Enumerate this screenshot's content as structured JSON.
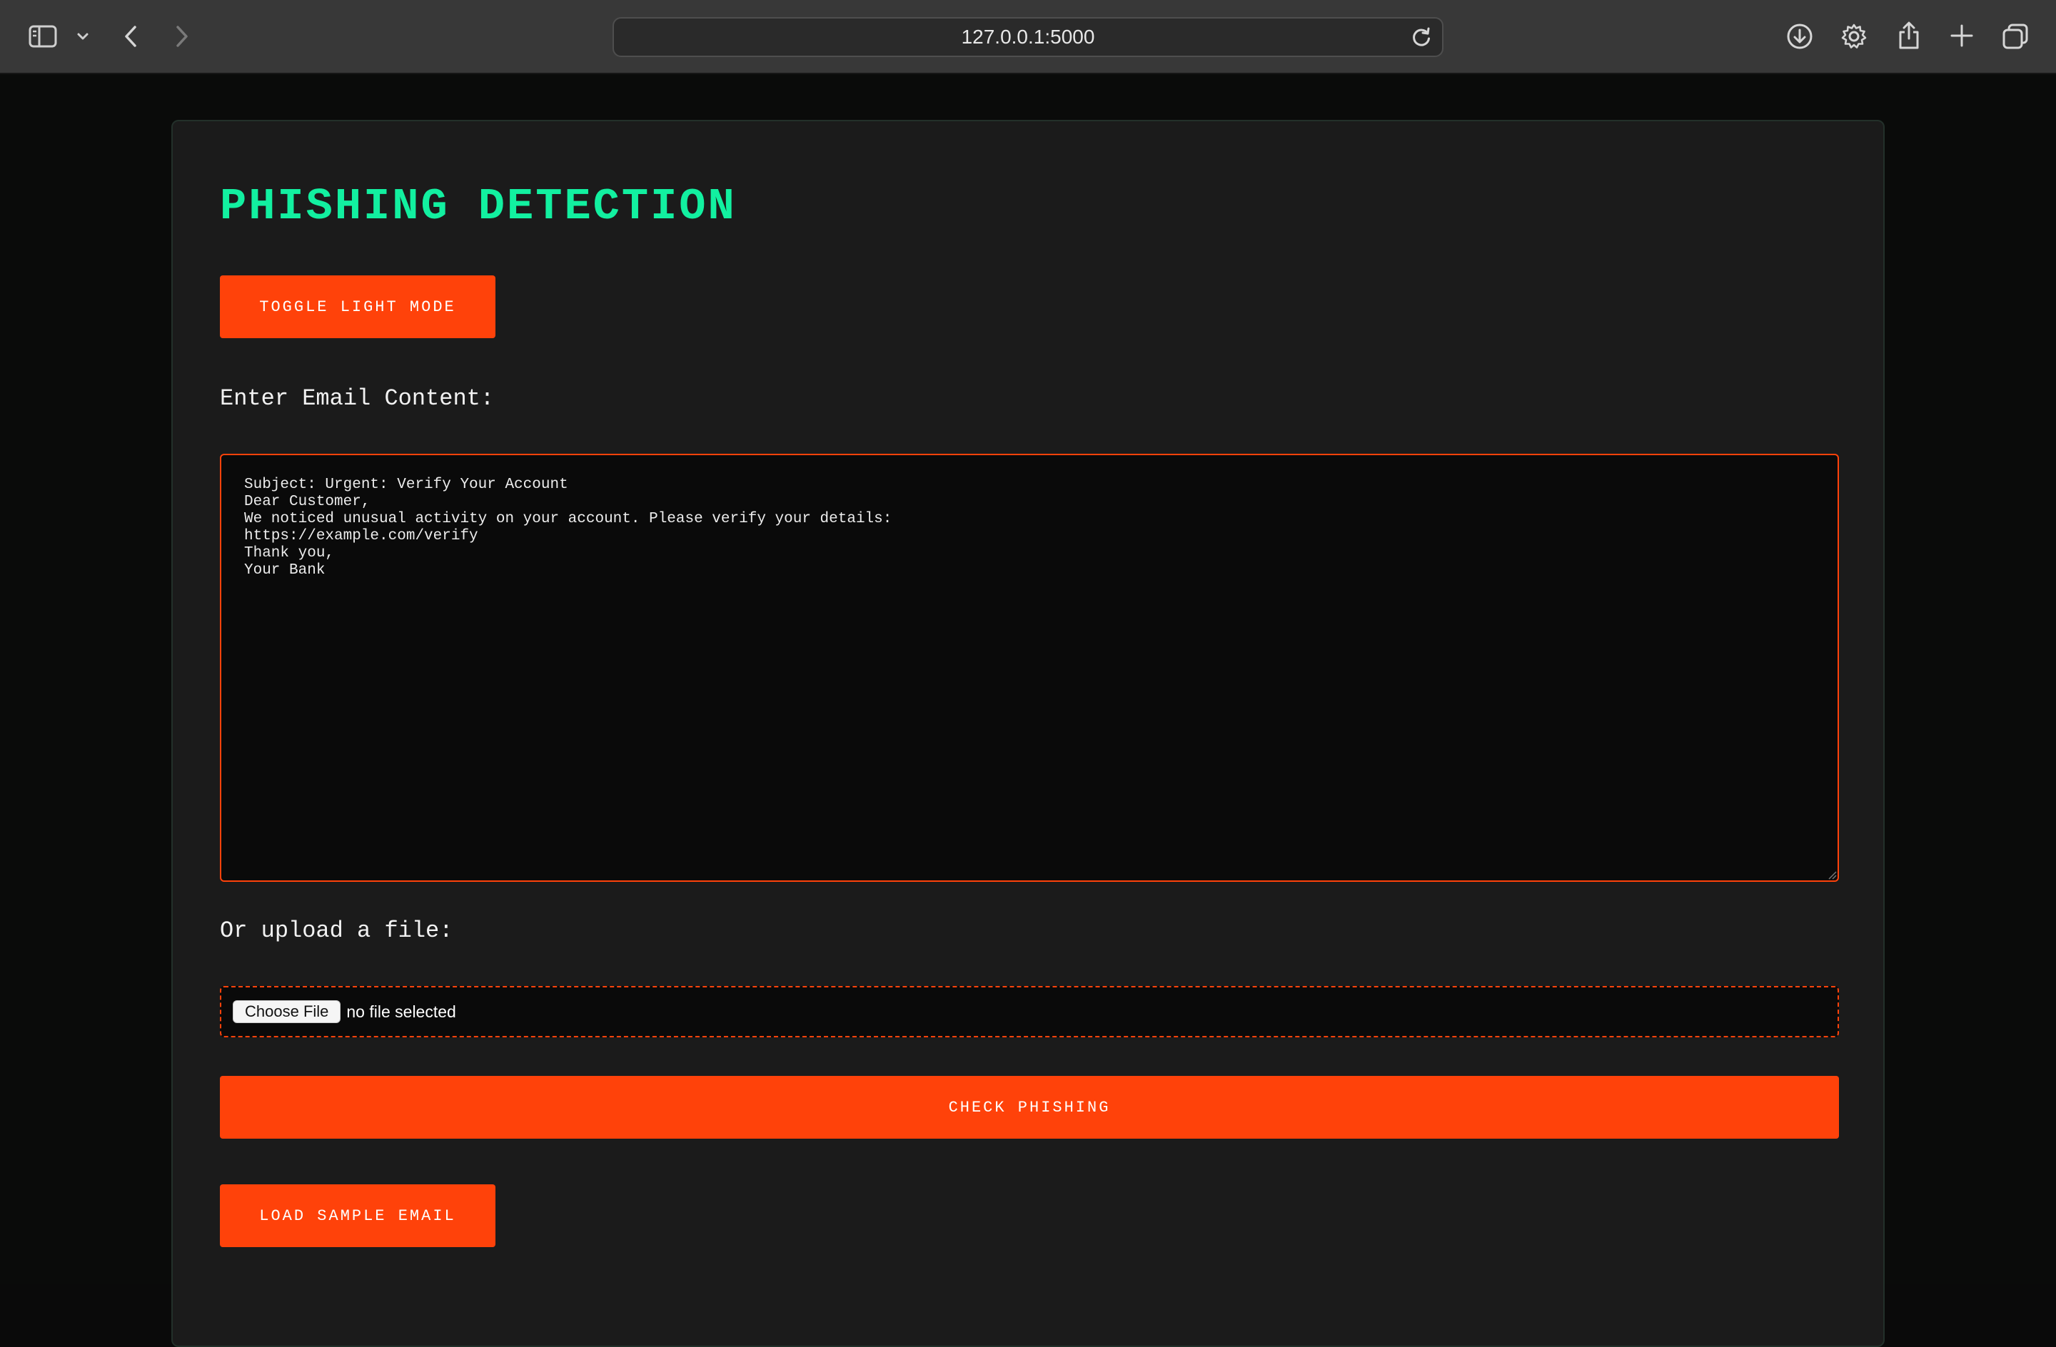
{
  "browser": {
    "url": "127.0.0.1:5000",
    "icons": {
      "sidebar": "sidebar-icon",
      "tab_group": "chevron-down-icon",
      "back": "back-arrow-icon",
      "forward": "forward-arrow-icon",
      "reload": "reload-icon",
      "downloads": "download-icon",
      "settings": "gear-icon",
      "share": "share-icon",
      "new_tab": "plus-icon",
      "tabs_overview": "tabs-overview-icon"
    }
  },
  "page": {
    "title": "PHISHING DETECTION",
    "toggle_button": "TOGGLE LIGHT MODE",
    "email_label": "Enter Email Content:",
    "email_content": "Subject: Urgent: Verify Your Account\nDear Customer,\nWe noticed unusual activity on your account. Please verify your details:\nhttps://example.com/verify\nThank you,\nYour Bank",
    "upload_label": "Or upload a file:",
    "choose_file_button": "Choose File",
    "file_status": "no file selected",
    "check_button": "CHECK PHISHING",
    "sample_button": "LOAD SAMPLE EMAIL"
  },
  "colors": {
    "title": "#12f0a0",
    "accent": "#ff420a",
    "card_background": "#1b1b1b",
    "page_background": "#0a0a0a",
    "input_background": "#0a0a0a"
  }
}
